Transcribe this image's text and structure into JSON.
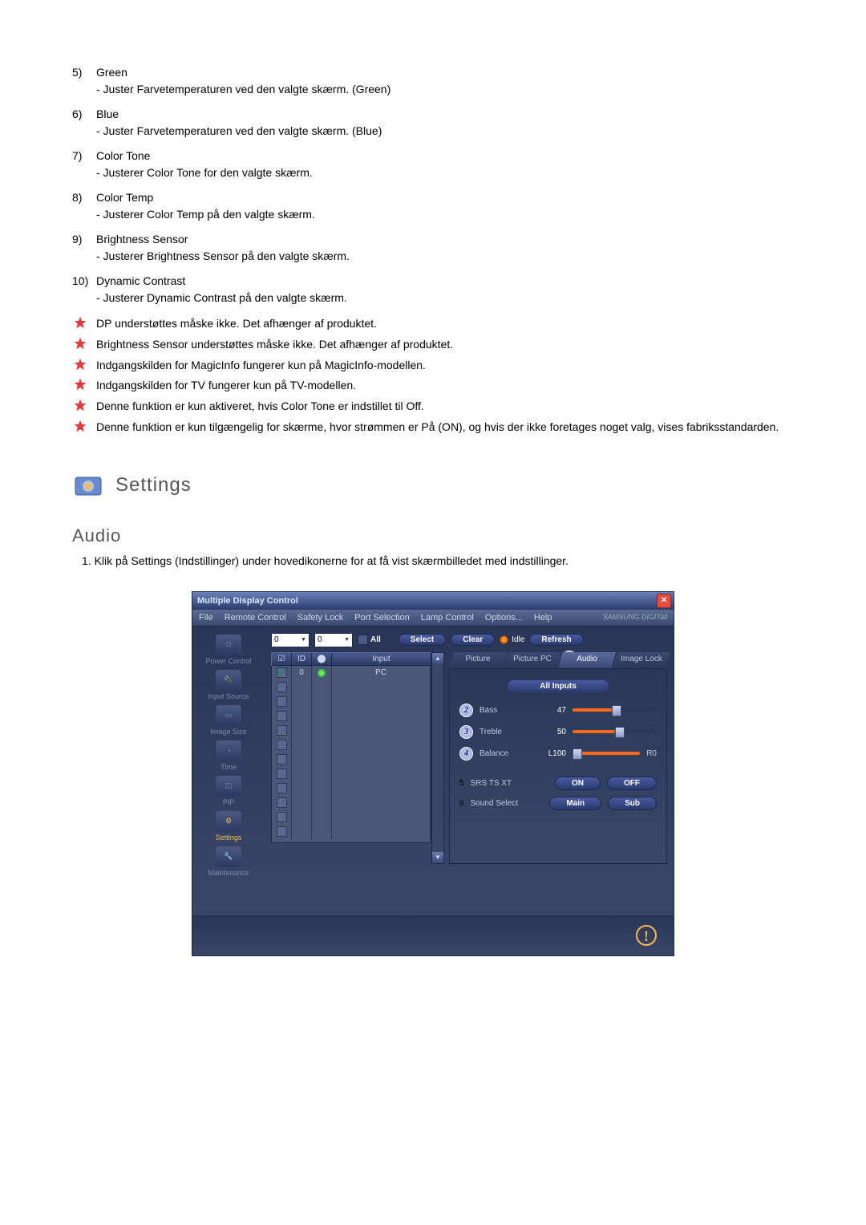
{
  "list": {
    "items": [
      {
        "num": "5)",
        "title": "Green",
        "desc": "- Juster Farvetemperaturen ved den valgte skærm. (Green)"
      },
      {
        "num": "6)",
        "title": "Blue",
        "desc": "- Juster Farvetemperaturen ved den valgte skærm. (Blue)"
      },
      {
        "num": "7)",
        "title": "Color Tone",
        "desc": "- Justerer Color Tone for den valgte skærm."
      },
      {
        "num": "8)",
        "title": "Color Temp",
        "desc": "- Justerer Color Temp på den valgte skærm."
      },
      {
        "num": "9)",
        "title": "Brightness Sensor",
        "desc": "- Justerer Brightness Sensor på den valgte skærm."
      },
      {
        "num": "10)",
        "title": "Dynamic Contrast",
        "desc": "- Justerer Dynamic Contrast på den valgte skærm."
      }
    ],
    "stars": [
      "DP understøttes måske ikke. Det afhænger af produktet.",
      "Brightness Sensor understøttes måske ikke. Det afhænger af produktet.",
      "Indgangskilden for MagicInfo fungerer kun på MagicInfo-modellen.",
      "Indgangskilden for TV fungerer kun på TV-modellen.",
      "Denne funktion er kun aktiveret, hvis Color Tone er indstillet til Off.",
      "Denne funktion er kun tilgængelig for skærme, hvor strømmen er På (ON), og hvis der ikke foretages noget valg, vises fabriksstandarden."
    ]
  },
  "settings_heading": "Settings",
  "audio": {
    "heading": "Audio",
    "step1": "1.  Klik på Settings (Indstillinger) under hovedikonerne for at få vist skærmbilledet med indstillinger."
  },
  "app": {
    "title": "Multiple Display Control",
    "brand": "SAMSUNG DIGITall",
    "menus": [
      "File",
      "Remote Control",
      "Safety Lock",
      "Port Selection",
      "Lamp Control",
      "Options...",
      "Help"
    ],
    "sidebar": [
      {
        "label": "Power Control"
      },
      {
        "label": "Input Source"
      },
      {
        "label": "Image Size"
      },
      {
        "label": "Time"
      },
      {
        "label": "PIP"
      },
      {
        "label": "Settings"
      },
      {
        "label": "Maintenance"
      }
    ],
    "toolbar": {
      "drop1": "0",
      "drop2": "0",
      "all": "All",
      "select": "Select",
      "clear": "Clear",
      "idle": "Idle",
      "refresh": "Refresh"
    },
    "table": {
      "heads": {
        "c2": "ID",
        "c4": "Input"
      },
      "rows": [
        {
          "checked": true,
          "id": "0",
          "input": "PC"
        }
      ]
    },
    "tabs": [
      "Picture",
      "Picture PC",
      "Audio",
      "Image Lock"
    ],
    "panel": {
      "all_inputs": "All Inputs",
      "bass": {
        "label": "Bass",
        "val": "47"
      },
      "treble": {
        "label": "Treble",
        "val": "50"
      },
      "balance": {
        "label": "Balance",
        "lval": "L100",
        "rval": "R0"
      },
      "srs": {
        "label": "SRS TS XT",
        "on": "ON",
        "off": "OFF"
      },
      "sound": {
        "label": "Sound Select",
        "main": "Main",
        "sub": "Sub"
      }
    },
    "callouts": {
      "c1": "1",
      "c2": "2",
      "c3": "3",
      "c4": "4",
      "c5": "5",
      "c6": "6"
    }
  }
}
